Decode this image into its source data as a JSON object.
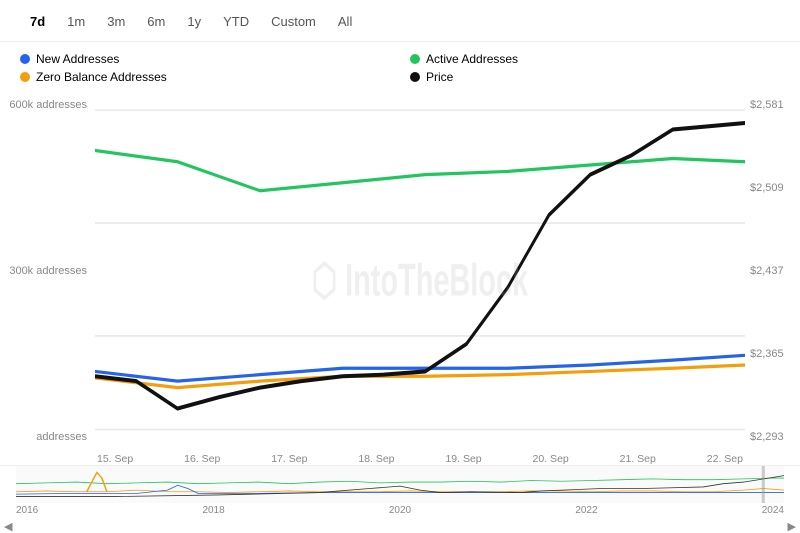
{
  "timeFilters": {
    "buttons": [
      "7d",
      "1m",
      "3m",
      "6m",
      "1y",
      "YTD",
      "Custom",
      "All"
    ],
    "active": "7d"
  },
  "legend": {
    "items": [
      {
        "label": "New Addresses",
        "color": "blue"
      },
      {
        "label": "Active Addresses",
        "color": "green"
      },
      {
        "label": "Zero Balance Addresses",
        "color": "orange"
      },
      {
        "label": "Price",
        "color": "black"
      }
    ]
  },
  "yAxisLeft": {
    "labels": [
      "600k addresses",
      "300k addresses",
      "addresses"
    ]
  },
  "yAxisRight": {
    "labels": [
      "$2,581",
      "$2,509",
      "$2,437",
      "$2,365",
      "$2,293"
    ]
  },
  "xAxis": {
    "labels": [
      "15. Sep",
      "16. Sep",
      "17. Sep",
      "18. Sep",
      "19. Sep",
      "20. Sep",
      "21. Sep",
      "22. Sep"
    ]
  },
  "miniXAxis": {
    "labels": [
      "2016",
      "2018",
      "2020",
      "2022",
      "2024"
    ]
  },
  "watermark": "IntoTheBlock"
}
